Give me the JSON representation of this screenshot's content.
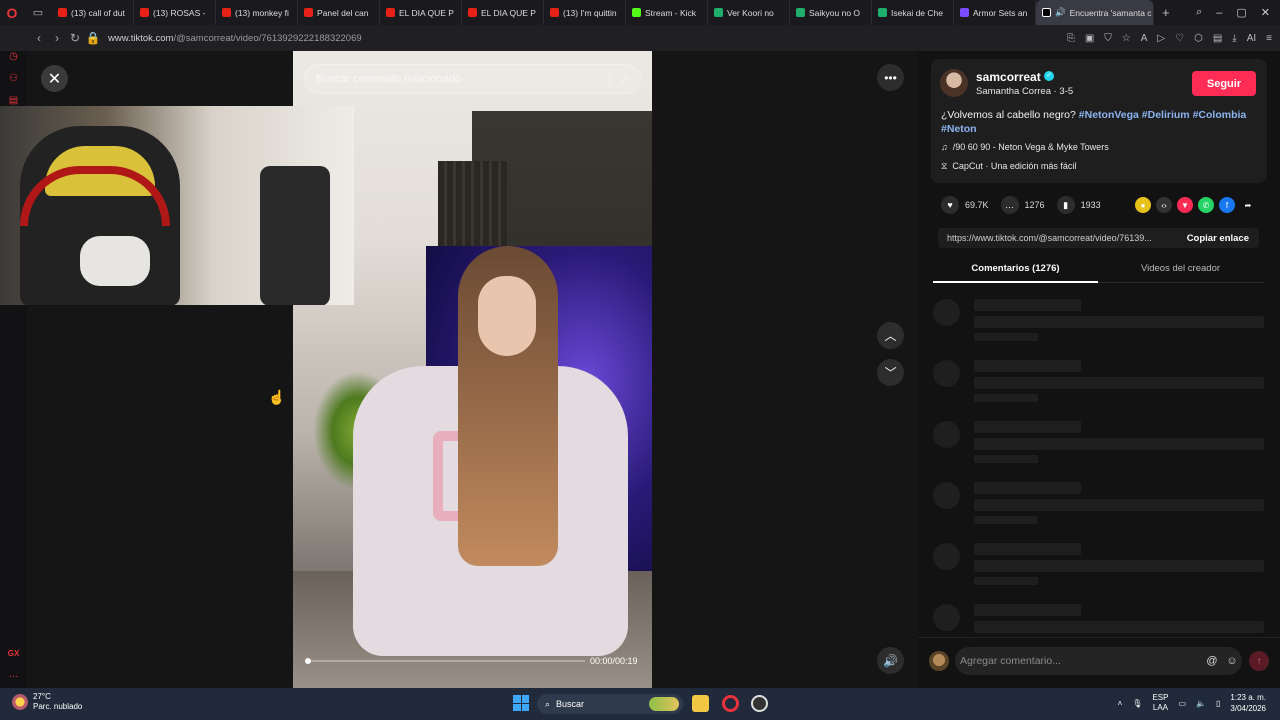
{
  "browser": {
    "tabs": [
      {
        "label": "(13) call of dut",
        "color": "#e62117"
      },
      {
        "label": "(13) ROSAS -",
        "color": "#e62117"
      },
      {
        "label": "(13) monkey fi",
        "color": "#e62117"
      },
      {
        "label": "Panel del can",
        "color": "#e62117"
      },
      {
        "label": "EL DIA QUE P",
        "color": "#e62117"
      },
      {
        "label": "EL DIA QUE P",
        "color": "#e62117"
      },
      {
        "label": "(13) I'm quittin",
        "color": "#e62117"
      },
      {
        "label": "Stream - Kick",
        "color": "#53fc18"
      },
      {
        "label": "Ver Koori no",
        "color": "#1fae6b"
      },
      {
        "label": "Saikyou no O",
        "color": "#1fae6b"
      },
      {
        "label": "Isekai de Che",
        "color": "#1fae6b"
      },
      {
        "label": "Armor Sets an",
        "color": "#7a4cff"
      }
    ],
    "active_tab": "Encuentra 'samanta c",
    "new_tab": "+",
    "url_host": "www.tiktok.com",
    "url_path": "/@samcorreat/video/7613929222188322069"
  },
  "video": {
    "search_placeholder": "Buscar contenido relacionado",
    "time": "00:00/00:19",
    "progress": 0.0
  },
  "creator": {
    "username": "samcorreat",
    "display_name": "Samantha Correa · 3-5",
    "follow": "Seguir",
    "description": "¿Volvemos al cabello negro?",
    "hashtags": [
      "#NetonVega",
      "#Delirium",
      "#Colombia",
      "#Neton"
    ],
    "music": "/90 60 90 - Neton Vega & Myke Towers",
    "capcut": "CapCut · Una edición más fácil"
  },
  "stats": {
    "likes": "69.7K",
    "comments": "1276",
    "saves": "1933"
  },
  "share": {
    "link": "https://www.tiktok.com/@samcorreat/video/76139...",
    "copy": "Copiar enlace"
  },
  "panel_tabs": {
    "comments": "Comentarios (1276)",
    "videos": "Videos del creador"
  },
  "comment": {
    "placeholder": "Agregar comentario..."
  },
  "taskbar": {
    "temp": "27°C",
    "weather": "Parc. nublado",
    "search": "Buscar",
    "lang1": "ESP",
    "lang2": "LAA",
    "time": "1:23 a. m.",
    "date": "3/04/2026"
  },
  "sidebar_label": "GX",
  "colors": {
    "follow": "#fe2c55",
    "hashtag": "#8bb4f0",
    "verified": "#20d5ec"
  }
}
